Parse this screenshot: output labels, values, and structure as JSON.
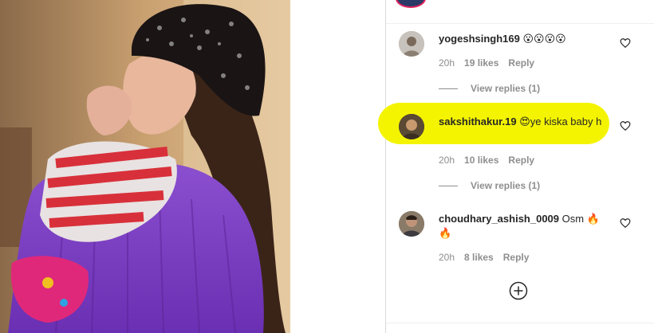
{
  "comments": [
    {
      "username": "yogeshsingh169",
      "text": "😮😮😮😮",
      "time": "20h",
      "likes": "19 likes",
      "reply": "Reply",
      "view_replies": "View replies (1)"
    },
    {
      "username": "sakshithakur.19",
      "text": "😍ye kiska baby h",
      "time": "20h",
      "likes": "10 likes",
      "reply": "Reply",
      "view_replies": "View replies (1)"
    },
    {
      "username": "choudhary_ashish_0009",
      "text": "Osm 🔥🔥",
      "time": "20h",
      "likes": "8 likes",
      "reply": "Reply"
    }
  ],
  "colors": {
    "highlight": "#f4f400",
    "muted": "#8e8e8e",
    "text": "#262626"
  },
  "icons": {
    "like": "heart-outline-icon",
    "load_more": "plus-circle-icon"
  }
}
